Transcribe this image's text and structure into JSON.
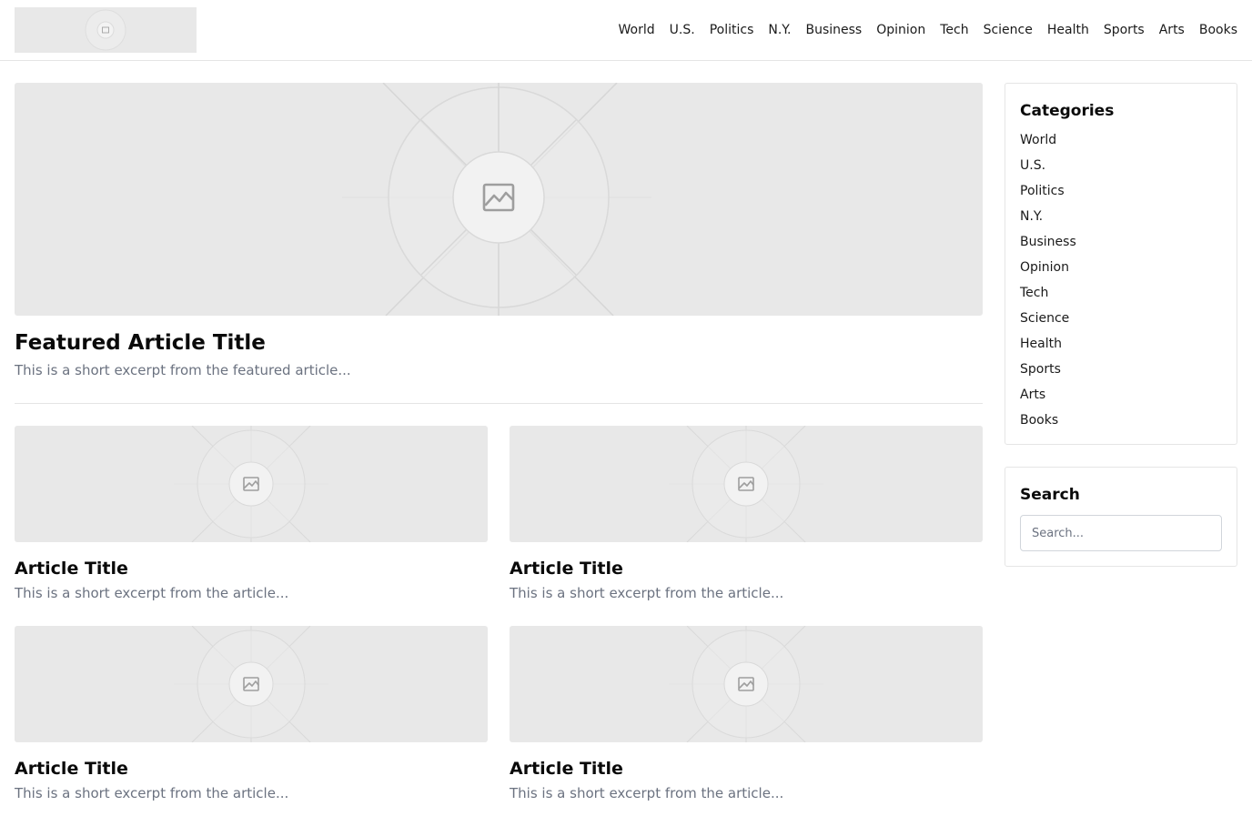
{
  "header": {
    "nav": [
      "World",
      "U.S.",
      "Politics",
      "N.Y.",
      "Business",
      "Opinion",
      "Tech",
      "Science",
      "Health",
      "Sports",
      "Arts",
      "Books"
    ]
  },
  "featured": {
    "title": "Featured Article Title",
    "excerpt": "This is a short excerpt from the featured article..."
  },
  "articles": [
    {
      "title": "Article Title",
      "excerpt": "This is a short excerpt from the article..."
    },
    {
      "title": "Article Title",
      "excerpt": "This is a short excerpt from the article..."
    },
    {
      "title": "Article Title",
      "excerpt": "This is a short excerpt from the article..."
    },
    {
      "title": "Article Title",
      "excerpt": "This is a short excerpt from the article..."
    }
  ],
  "sidebar": {
    "categories_title": "Categories",
    "categories": [
      "World",
      "U.S.",
      "Politics",
      "N.Y.",
      "Business",
      "Opinion",
      "Tech",
      "Science",
      "Health",
      "Sports",
      "Arts",
      "Books"
    ],
    "search_title": "Search",
    "search_placeholder": "Search..."
  },
  "icons": {
    "placeholder": "image-placeholder-icon"
  }
}
